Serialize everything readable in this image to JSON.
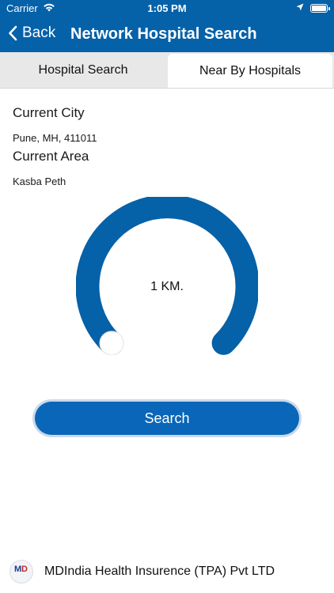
{
  "status_bar": {
    "carrier": "Carrier",
    "time": "1:05 PM"
  },
  "nav": {
    "back_label": "Back",
    "title": "Network Hospital Search"
  },
  "tabs": [
    {
      "label": "Hospital Search",
      "selected": false
    },
    {
      "label": "Near By Hospitals",
      "selected": true
    }
  ],
  "location": {
    "city_label": "Current City",
    "city_value": "Pune, MH, 411011",
    "area_label": "Current Area",
    "area_value": "Kasba Peth"
  },
  "distance": {
    "value_text": "1 KM.",
    "accent_color": "#0561a8"
  },
  "search_button": {
    "label": "Search"
  },
  "footer": {
    "company": "MDIndia Health Insurence (TPA) Pvt LTD",
    "logo_text": "MD"
  },
  "icons": [
    "wifi-icon",
    "location-arrow-icon",
    "battery-icon",
    "chevron-left-icon",
    "mdindia-logo"
  ]
}
